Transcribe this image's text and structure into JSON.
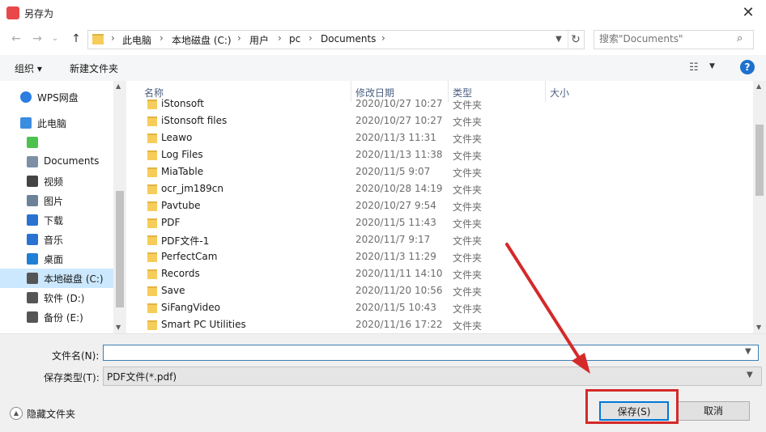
{
  "window": {
    "title": "另存为",
    "close": "✕"
  },
  "nav": {
    "back": "←",
    "forward": "→",
    "recent": "⌄",
    "up": "↑",
    "breadcrumbs": [
      "此电脑",
      "本地磁盘 (C:)",
      "用户",
      "pc",
      "Documents"
    ],
    "refresh": "↻",
    "search_placeholder": "搜索\"Documents\"",
    "search_icon": "⌕"
  },
  "toolbar": {
    "organize": "组织 ▾",
    "new_folder": "新建文件夹",
    "view": "☷",
    "help": "?"
  },
  "sidebar": {
    "items": [
      {
        "label": "WPS网盘",
        "icon": "cloud-icon",
        "color": "#2b7de0",
        "top": true
      },
      {
        "label": "此电脑",
        "icon": "computer-icon",
        "color": "#3b8de0",
        "top": true
      },
      {
        "label": "",
        "icon": "app-icon",
        "color": "#4ec24e"
      },
      {
        "label": "Documents",
        "icon": "documents-icon",
        "color": "#7d8fa5"
      },
      {
        "label": "视频",
        "icon": "video-icon",
        "color": "#444444"
      },
      {
        "label": "图片",
        "icon": "pictures-icon",
        "color": "#6c8299"
      },
      {
        "label": "下载",
        "icon": "download-icon",
        "color": "#2a72d1"
      },
      {
        "label": "音乐",
        "icon": "music-icon",
        "color": "#2a72d1"
      },
      {
        "label": "桌面",
        "icon": "desktop-icon",
        "color": "#1f7fd6"
      },
      {
        "label": "本地磁盘 (C:)",
        "icon": "drive-icon",
        "color": "#555555",
        "selected": true
      },
      {
        "label": "软件 (D:)",
        "icon": "drive-icon",
        "color": "#555555"
      },
      {
        "label": "备份 (E:)",
        "icon": "drive-icon",
        "color": "#555555"
      }
    ]
  },
  "columns": {
    "name": "名称",
    "date": "修改日期",
    "type": "类型",
    "size": "大小"
  },
  "files": [
    {
      "name": "iStonsoft",
      "date": "2020/10/27 10:27",
      "type": "文件夹"
    },
    {
      "name": "iStonsoft files",
      "date": "2020/10/27 10:27",
      "type": "文件夹"
    },
    {
      "name": "Leawo",
      "date": "2020/11/3 11:31",
      "type": "文件夹"
    },
    {
      "name": "Log Files",
      "date": "2020/11/13 11:38",
      "type": "文件夹"
    },
    {
      "name": "MiaTable",
      "date": "2020/11/5 9:07",
      "type": "文件夹"
    },
    {
      "name": "ocr_jm189cn",
      "date": "2020/10/28 14:19",
      "type": "文件夹"
    },
    {
      "name": "Pavtube",
      "date": "2020/10/27 9:54",
      "type": "文件夹"
    },
    {
      "name": "PDF",
      "date": "2020/11/5 11:43",
      "type": "文件夹"
    },
    {
      "name": "PDF文件-1",
      "date": "2020/11/7 9:17",
      "type": "文件夹"
    },
    {
      "name": "PerfectCam",
      "date": "2020/11/3 11:29",
      "type": "文件夹"
    },
    {
      "name": "Records",
      "date": "2020/11/11 14:10",
      "type": "文件夹"
    },
    {
      "name": "Save",
      "date": "2020/11/20 10:56",
      "type": "文件夹"
    },
    {
      "name": "SiFangVideo",
      "date": "2020/11/5 10:43",
      "type": "文件夹"
    },
    {
      "name": "Smart PC Utilities",
      "date": "2020/11/16 17:22",
      "type": "文件夹"
    }
  ],
  "form": {
    "filename_label": "文件名(N):",
    "filename_value": "",
    "type_label": "保存类型(T):",
    "type_value": "PDF文件(*.pdf)",
    "hide_folders": "隐藏文件夹",
    "save": "保存(S)",
    "cancel": "取消"
  },
  "annotation_color": "#d42a2a"
}
